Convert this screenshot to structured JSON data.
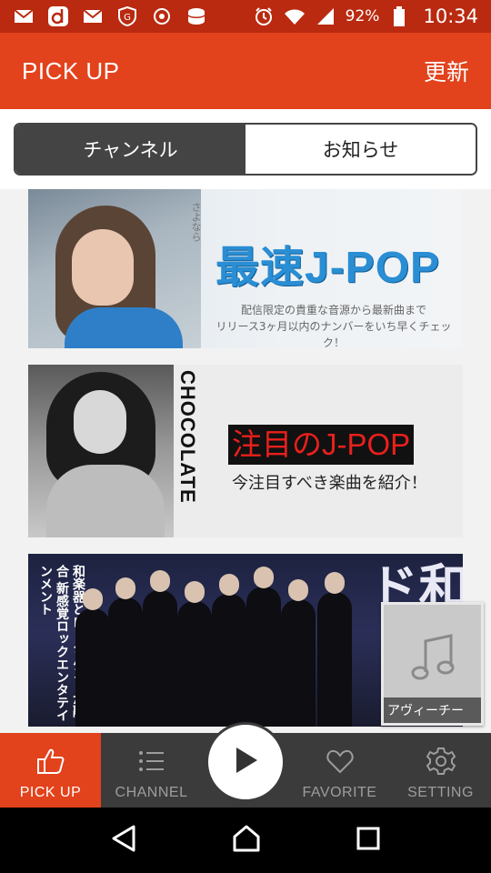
{
  "status_bar": {
    "left_icons": [
      "mail-icon",
      "d-icon",
      "mail-icon",
      "shield-icon",
      "recorder-icon",
      "storage-icon"
    ],
    "right_icons": [
      "alarm-icon",
      "wifi-icon",
      "signal-icon"
    ],
    "battery": "92%",
    "time": "10:34"
  },
  "app_bar": {
    "title": "PICK UP",
    "refresh_label": "更新"
  },
  "tabs": [
    {
      "label": "チャンネル",
      "active": true
    },
    {
      "label": "お知らせ",
      "active": false
    }
  ],
  "banners": [
    {
      "title": "最速J-POP",
      "subtitle_line1": "配信限定の貴重な音源から最新曲まで",
      "subtitle_line2": "リリース3ヶ月以内のナンバーをいち早くチェック！",
      "vertical_text": "さよなら"
    },
    {
      "title": "注目のJ-POP",
      "subtitle": "今注目すべき楽曲を紹介！",
      "side_text": "CHOCOLATE"
    },
    {
      "left_text": "和楽器とロックバンドが融合 新感覚ロックエンタテインメント",
      "big_text": "和バンド"
    }
  ],
  "mini_player": {
    "label": "アヴィーチー"
  },
  "bottom_nav": {
    "items": [
      {
        "label": "PICK UP",
        "icon": "thumbs-up-icon",
        "active": true
      },
      {
        "label": "CHANNEL",
        "icon": "list-icon",
        "active": false
      },
      {
        "label": "FAVORITE",
        "icon": "heart-icon",
        "active": false
      },
      {
        "label": "SETTING",
        "icon": "gear-icon",
        "active": false
      }
    ],
    "play_icon": "play-icon"
  },
  "system_nav": [
    "back-icon",
    "home-icon",
    "recents-icon"
  ],
  "colors": {
    "status_bar": "#b92a10",
    "accent": "#e2421c",
    "nav_bg": "#3b3b3b",
    "tab_active": "#444444"
  }
}
